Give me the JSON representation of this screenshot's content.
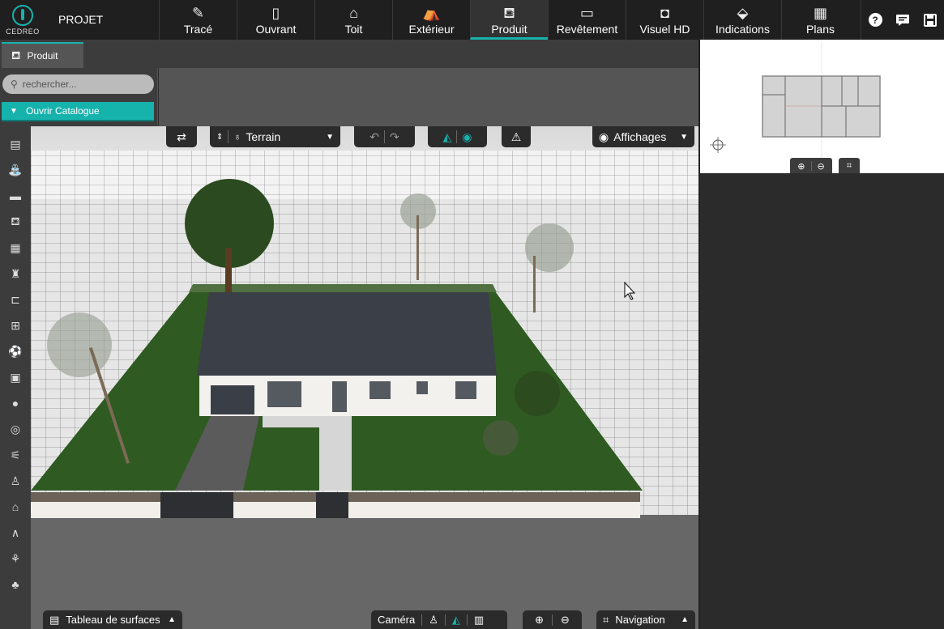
{
  "app": {
    "logo_text": "CEDREO",
    "project_label": "PROJET"
  },
  "menu": [
    {
      "id": "trace",
      "label": "Tracé",
      "icon": "pencil-icon"
    },
    {
      "id": "ouvrant",
      "label": "Ouvrant",
      "icon": "door-icon"
    },
    {
      "id": "toit",
      "label": "Toit",
      "icon": "roof-icon"
    },
    {
      "id": "exterieur",
      "label": "Extérieur",
      "icon": "exterior-icon"
    },
    {
      "id": "produit",
      "label": "Produit",
      "icon": "furniture-icon",
      "active": true
    },
    {
      "id": "revetement",
      "label": "Revêtement",
      "icon": "paint-roller-icon"
    },
    {
      "id": "visuel",
      "label": "Visuel HD",
      "icon": "camera-icon"
    },
    {
      "id": "indications",
      "label": "Indications",
      "icon": "measure-icon"
    },
    {
      "id": "plans",
      "label": "Plans",
      "icon": "plans-icon"
    }
  ],
  "top_right": {
    "help": "?",
    "chat_icon": "chat-icon",
    "save_icon": "save-icon"
  },
  "tab": {
    "label": "Produit",
    "icon": "furniture-icon"
  },
  "search": {
    "placeholder": "rechercher..."
  },
  "catalog": {
    "label": "Ouvrir Catalogue"
  },
  "left_tools": [
    "kitchen-icon",
    "bathroom-icon",
    "bed-icon",
    "living-icon",
    "storage-icon",
    "lamp-icon",
    "bed-frame-icon",
    "office-icon",
    "ball-icon",
    "tv-icon",
    "lightbulb-icon",
    "compass-icon",
    "stairs-icon",
    "person-icon",
    "house-icon",
    "roof-line-icon",
    "garden-icon",
    "trees-icon"
  ],
  "viewport_top": {
    "terrain_label": "Terrain",
    "affichages_label": "Affichages"
  },
  "viewport_bottom": {
    "surfaces_label": "Tableau de surfaces",
    "camera_label": "Caméra",
    "navigation_label": "Navigation"
  },
  "colors": {
    "accent": "#16b2ac",
    "topbar": "#1f1f1f",
    "panel": "#3c3c3c",
    "grass": "#2f5a22",
    "roof": "#3b4048"
  }
}
